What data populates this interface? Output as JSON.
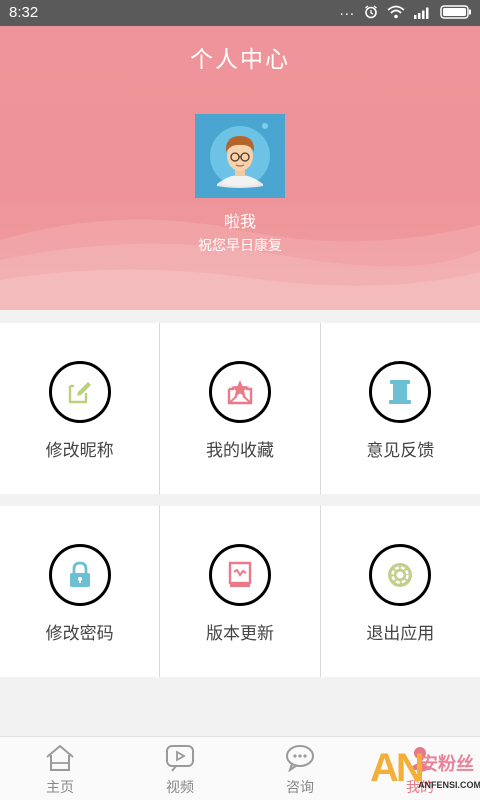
{
  "status_bar": {
    "time": "8:32",
    "dots": "...",
    "icons": [
      "alarm-icon",
      "wifi-icon",
      "signal-icon",
      "battery-icon"
    ]
  },
  "header": {
    "title": "个人中心",
    "nickname": "啦我",
    "tagline": "祝您早日康复",
    "colors": {
      "background": "#ee9498"
    }
  },
  "menu": {
    "row1": [
      {
        "label": "修改昵称",
        "icon": "edit-icon",
        "color": "#bbd07f"
      },
      {
        "label": "我的收藏",
        "icon": "favorite-star-icon",
        "color": "#ea7a88"
      },
      {
        "label": "意见反馈",
        "icon": "scroll-icon",
        "color": "#6dbfd3"
      }
    ],
    "row2": [
      {
        "label": "修改密码",
        "icon": "lock-icon",
        "color": "#6dbfd3"
      },
      {
        "label": "版本更新",
        "icon": "update-icon",
        "color": "#ea7a88"
      },
      {
        "label": "退出应用",
        "icon": "gear-icon",
        "color": "#c3cf8d"
      }
    ]
  },
  "bottom_nav": [
    {
      "label": "主页",
      "icon": "home-icon"
    },
    {
      "label": "视频",
      "icon": "video-icon"
    },
    {
      "label": "咨询",
      "icon": "chat-icon"
    },
    {
      "label": "我的",
      "icon": "profile-icon",
      "active": true
    }
  ],
  "watermark": {
    "logo": "AN",
    "text": "安粉丝",
    "url": "ANFENSI.COM"
  }
}
